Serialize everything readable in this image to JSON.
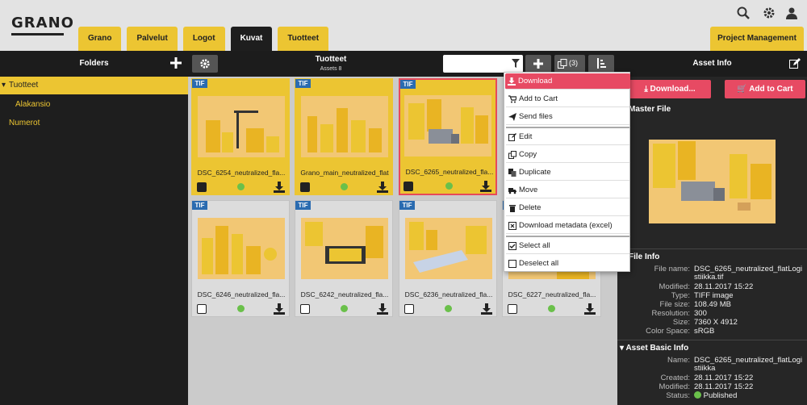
{
  "brand": {
    "logo": "GRANO"
  },
  "tabs": [
    {
      "label": "Grano"
    },
    {
      "label": "Palvelut"
    },
    {
      "label": "Logot"
    },
    {
      "label": "Kuvat"
    },
    {
      "label": "Tuotteet"
    }
  ],
  "active_tab": "Kuvat",
  "project_tab": {
    "label": "Project Management"
  },
  "folders": {
    "title": "Folders",
    "items": [
      {
        "label": "Tuotteet",
        "expanded": true,
        "selected": true
      },
      {
        "label": "Alakansio"
      },
      {
        "label": "Numerot"
      }
    ]
  },
  "assets": {
    "title": "Tuotteet",
    "count": "Assets 8",
    "copy_count": "(3)",
    "filter_placeholder": "",
    "cards": [
      {
        "type": "TIF",
        "name": "DSC_6254_neutralized_fla...",
        "selected": true
      },
      {
        "type": "TIF",
        "name": "Grano_main_neutralized_flat",
        "selected": true
      },
      {
        "type": "TIF",
        "name": "DSC_6265_neutralized_fla...",
        "selected": true,
        "active": true
      },
      {
        "type": "TIF",
        "name": "DSC_6246_neutralized_fla...",
        "selected": false
      },
      {
        "type": "TIF",
        "name": "DSC_6242_neutralized_fla...",
        "selected": false
      },
      {
        "type": "TIF",
        "name": "DSC_6236_neutralized_fla...",
        "selected": false
      },
      {
        "type": "TIF",
        "name": "DSC_6227_neutralized_fla...",
        "selected": false
      }
    ]
  },
  "context_menu": {
    "items": [
      {
        "label": "Download",
        "icon": "download-icon"
      },
      {
        "label": "Add to Cart",
        "icon": "cart-icon"
      },
      {
        "label": "Send files",
        "icon": "send-icon"
      },
      {
        "label": "Edit",
        "icon": "edit-icon"
      },
      {
        "label": "Copy",
        "icon": "copy-icon"
      },
      {
        "label": "Duplicate",
        "icon": "duplicate-icon"
      },
      {
        "label": "Move",
        "icon": "truck-icon"
      },
      {
        "label": "Delete",
        "icon": "trash-icon"
      },
      {
        "label": "Download metadata (excel)",
        "icon": "excel-icon"
      },
      {
        "label": "Select all",
        "icon": "checkbox-checked-icon"
      },
      {
        "label": "Deselect all",
        "icon": "checkbox-empty-icon"
      }
    ]
  },
  "asset_info": {
    "title": "Asset Info",
    "download_btn": "Download...",
    "cart_btn": "Add to Cart",
    "master_file": "Master File",
    "file_info_title": "File Info",
    "file_info": [
      {
        "k": "File name:",
        "v1": "DSC_6265_neutralized_flatLogi",
        "v2": "stiikka.tif"
      },
      {
        "k": "Modified:",
        "v1": "28.11.2017 15:22"
      },
      {
        "k": "Type:",
        "v1": "TIFF image"
      },
      {
        "k": "File size:",
        "v1": "108.49 MB"
      },
      {
        "k": "Resolution:",
        "v1": "300"
      },
      {
        "k": "Size:",
        "v1": "7360 X 4912"
      },
      {
        "k": "Color Space:",
        "v1": "sRGB"
      }
    ],
    "basic_title": "Asset Basic Info",
    "basic_info": [
      {
        "k": "Name:",
        "v1": "DSC_6265_neutralized_flatLogi",
        "v2": "stiikka"
      },
      {
        "k": "Created:",
        "v1": "28.11.2017 15:22"
      },
      {
        "k": "Modified:",
        "v1": "28.11.2017 15:22"
      },
      {
        "k": "Status:",
        "v1": "Published"
      }
    ]
  },
  "colors": {
    "accent": "#ecc532",
    "highlight": "#e74a63",
    "dark": "#1e1e1e",
    "badge": "#2a6bb0",
    "ok": "#6ac04a"
  }
}
